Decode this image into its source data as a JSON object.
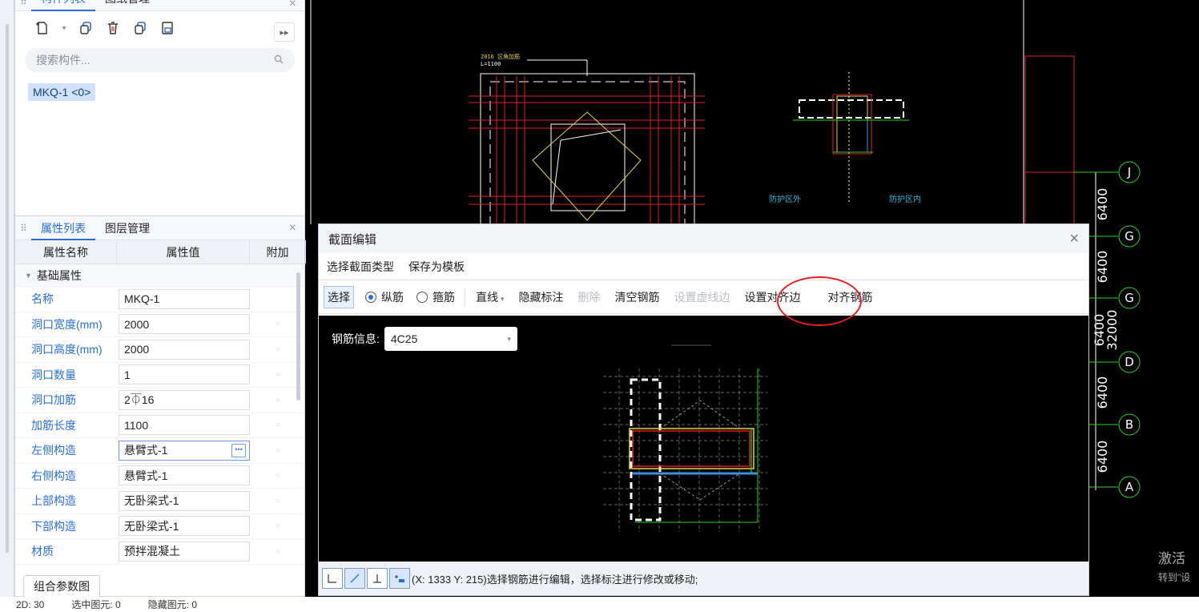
{
  "component_panel": {
    "tabs": [
      "构件列表",
      "图纸管理"
    ],
    "search_placeholder": "搜索构件...",
    "component_item": "MKQ-1 <0>"
  },
  "property_panel": {
    "tabs": [
      "属性列表",
      "图层管理"
    ],
    "headers": [
      "属性名称",
      "属性值",
      "附加"
    ],
    "group": "基础属性",
    "rows": [
      {
        "name": "名称",
        "value": "MKQ-1"
      },
      {
        "name": "洞口宽度(mm)",
        "value": "2000"
      },
      {
        "name": "洞口高度(mm)",
        "value": "2000"
      },
      {
        "name": "洞口数量",
        "value": "1"
      },
      {
        "name": "洞口加筋",
        "value": "2⏁16"
      },
      {
        "name": "加筋长度",
        "value": "1100"
      },
      {
        "name": "左侧构造",
        "value": "悬臂式-1"
      },
      {
        "name": "右侧构造",
        "value": "悬臂式-1"
      },
      {
        "name": "上部构造",
        "value": "无卧梁式-1"
      },
      {
        "name": "下部构造",
        "value": "无卧梁式-1"
      },
      {
        "name": "材质",
        "value": "预拌混凝土"
      }
    ],
    "combo_button": "组合参数图"
  },
  "dialog": {
    "title": "截面编辑",
    "menu": [
      "选择截面类型",
      "保存为模板"
    ],
    "tools": {
      "select": "选择",
      "longitudinal": "纵筋",
      "stirrup": "箍筋",
      "line": "直线",
      "hide_label": "隐藏标注",
      "delete": "删除",
      "clear_rebar": "清空钢筋",
      "set_dashed": "设置虚线边",
      "set_align": "设置对齐边",
      "align_rebar": "对齐钢筋"
    },
    "rebar_info_label": "钢筋信息:",
    "rebar_info_value": "4C25",
    "status_text": "(X: 1333 Y: 215)选择钢筋进行编辑，选择标注进行修改或移动;"
  },
  "cad": {
    "axis_labels": [
      "J",
      "G",
      "G",
      "D",
      "B",
      "A"
    ],
    "dims": [
      "6400",
      "6400",
      "6400",
      "32000",
      "6400",
      "6400"
    ],
    "plan_title": "2016 区角加筋",
    "plan_sub": "L=1100",
    "section_out": "防护区外",
    "section_in": "防护区内"
  },
  "bottom_status": [
    "2D: 30",
    "选中图元: 0",
    "隐藏图元: 0"
  ],
  "watermark": {
    "line1": "激活",
    "line2": "转到\"设"
  },
  "colors": {
    "accent": "#2a6fd6",
    "highlight": "#e02020",
    "cad_bg": "#000000"
  }
}
